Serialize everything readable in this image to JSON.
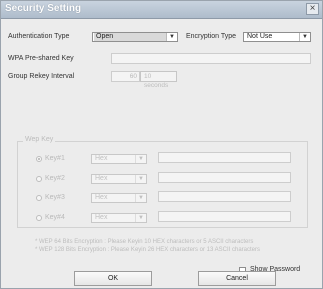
{
  "window": {
    "title": "Security Setting",
    "close_glyph": "×"
  },
  "auth": {
    "label": "Authentication Type",
    "value": "Open"
  },
  "encryption": {
    "label": "Encryption Type",
    "value": "Not Use"
  },
  "wpa": {
    "label": "WPA Pre-shared Key",
    "value": ""
  },
  "rekey": {
    "label": "Group Rekey Interval",
    "value": "60",
    "unit_button": "10 seconds"
  },
  "wep": {
    "legend": "Wep Key",
    "keys": [
      {
        "label": "Key#1",
        "format": "Hex",
        "value": "",
        "selected": true
      },
      {
        "label": "Key#2",
        "format": "Hex",
        "value": "",
        "selected": false
      },
      {
        "label": "Key#3",
        "format": "Hex",
        "value": "",
        "selected": false
      },
      {
        "label": "Key#4",
        "format": "Hex",
        "value": "",
        "selected": false
      }
    ],
    "notes": [
      "* WEP 64 Bits Encryption : Please Keyin 10 HEX characters or 5 ASCII characters",
      "* WEP 128 Bits Encryption : Please Keyin 26 HEX characters or 13 ASCII characters"
    ]
  },
  "show_password": {
    "label": "Show Password",
    "checked": false
  },
  "buttons": {
    "ok": "OK",
    "cancel": "Cancel"
  },
  "icons": {
    "close": "close-icon",
    "dropdown": "chevron-down-icon"
  }
}
